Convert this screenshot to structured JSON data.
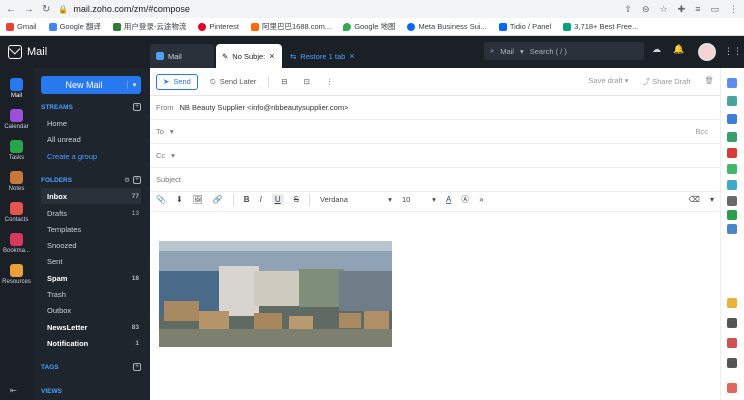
{
  "browser": {
    "url": "mail.zoho.com/zm/#compose",
    "bookmarks": [
      "Gmail",
      "Google 翻译",
      "用户登录-云途物流",
      "Pinterest",
      "阿里巴巴1688.com...",
      "Google 地图",
      "Meta Business Sui...",
      "Tidio / Panel",
      "3,718+ Best Free..."
    ]
  },
  "header": {
    "app_name": "Mail",
    "tabs": [
      {
        "label": "Mail"
      },
      {
        "label": "No Subje:"
      },
      {
        "label": "Restore 1 tab"
      }
    ],
    "search_scope": "Mail",
    "search_placeholder": "Search ( / )"
  },
  "rail": {
    "items": [
      "Mail",
      "Calendar",
      "Tasks",
      "Notes",
      "Contacts",
      "Bookma...",
      "Resources"
    ]
  },
  "sidebar": {
    "new_mail": "New Mail",
    "streams_title": "STREAMS",
    "streams": [
      "Home",
      "All unread"
    ],
    "create_group": "Create a group",
    "folders_title": "FOLDERS",
    "folders": [
      {
        "name": "Inbox",
        "count": "77"
      },
      {
        "name": "Drafts",
        "count": "13"
      },
      {
        "name": "Templates",
        "count": ""
      },
      {
        "name": "Snoozed",
        "count": ""
      },
      {
        "name": "Sent",
        "count": ""
      },
      {
        "name": "Spam",
        "count": "18"
      },
      {
        "name": "Trash",
        "count": ""
      },
      {
        "name": "Outbox",
        "count": ""
      },
      {
        "name": "NewsLetter",
        "count": "83"
      },
      {
        "name": "Notification",
        "count": "1"
      }
    ],
    "tags_title": "TAGS",
    "views_title": "VIEWS"
  },
  "compose": {
    "send": "Send",
    "send_later": "Send Later",
    "save_draft": "Save draft",
    "share_draft": "Share Draft",
    "from_label": "From",
    "from_value": "NB Beauty Supplier <info@nbbeautysupplier.com>",
    "to_label": "To",
    "cc_label": "Cc",
    "bcc_label": "Bcc",
    "subject_placeholder": "Subject",
    "font": "Verdana",
    "font_size": "10"
  }
}
